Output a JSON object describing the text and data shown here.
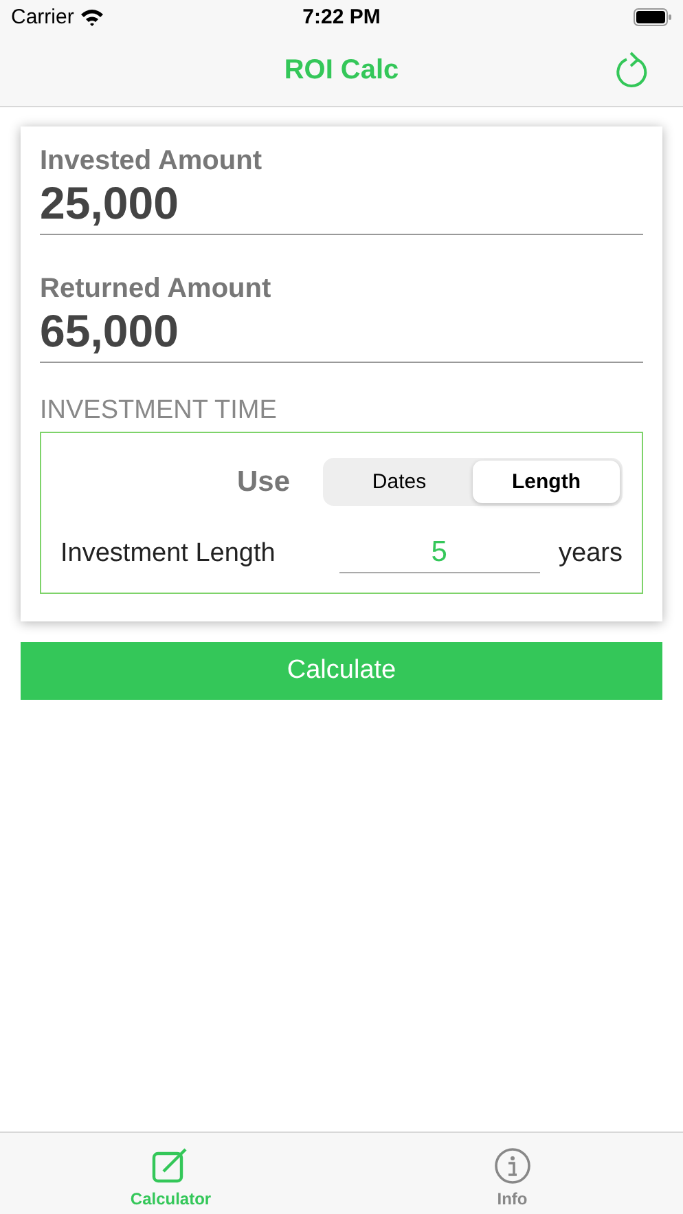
{
  "status_bar": {
    "carrier": "Carrier",
    "time": "7:22 PM"
  },
  "nav": {
    "title": "ROI Calc"
  },
  "fields": [
    {
      "label": "Invested Amount",
      "value": "25,000"
    },
    {
      "label": "Returned Amount",
      "value": "65,000"
    }
  ],
  "investment_time": {
    "heading": "INVESTMENT TIME",
    "use_label": "Use",
    "segments": [
      {
        "label": "Dates",
        "selected": false
      },
      {
        "label": "Length",
        "selected": true
      }
    ],
    "length_label": "Investment Length",
    "length_value": "5",
    "unit": "years"
  },
  "calculate_button": "Calculate",
  "tab_bar": [
    {
      "label": "Calculator",
      "kind": "edit",
      "selected": true
    },
    {
      "label": "Info",
      "kind": "info",
      "selected": false
    }
  ]
}
